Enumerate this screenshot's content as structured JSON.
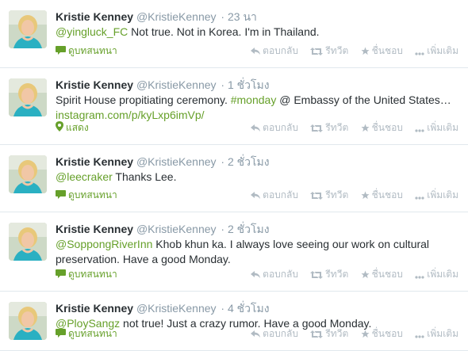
{
  "colors": {
    "link": "#66a02a",
    "muted": "#8899a6",
    "actions": "#b1bbc3",
    "border": "#e1e8ed"
  },
  "tweets": [
    {
      "name": "Kristie Kenney",
      "handle": "@KristieKenney",
      "sep": "·",
      "time": "23 นา",
      "parts": [
        {
          "t": "@yingluck_FC",
          "link": true
        },
        {
          "t": " Not true.  Not in Korea. I'm in Thailand.",
          "link": false
        }
      ],
      "expand": "ดูบทสนทนา",
      "expand_icon": "conversation-icon",
      "actions": {
        "reply": "ตอบกลับ",
        "retweet": "รีทวีต",
        "favorite": "ชื่นชอบ",
        "more": "เพิ่มเติม"
      }
    },
    {
      "name": "Kristie Kenney",
      "handle": "@KristieKenney",
      "sep": "·",
      "time": "1 ชั่วโมง",
      "parts": [
        {
          "t": "Spirit House propitiating ceremony. ",
          "link": false
        },
        {
          "t": "#monday",
          "link": true
        },
        {
          "t": " @ Embassy of the United States… ",
          "link": false
        },
        {
          "t": "instagram.com/p/kyLxp6imVp/",
          "link": true
        }
      ],
      "expand": "แสดง",
      "expand_icon": "location-pin-icon",
      "actions": {
        "reply": "ตอบกลับ",
        "retweet": "รีทวีต",
        "favorite": "ชื่นชอบ",
        "more": "เพิ่มเติม"
      }
    },
    {
      "name": "Kristie Kenney",
      "handle": "@KristieKenney",
      "sep": "·",
      "time": "2 ชั่วโมง",
      "parts": [
        {
          "t": "@leecraker",
          "link": true
        },
        {
          "t": " Thanks Lee.",
          "link": false
        }
      ],
      "expand": "ดูบทสนทนา",
      "expand_icon": "conversation-icon",
      "actions": {
        "reply": "ตอบกลับ",
        "retweet": "รีทวีต",
        "favorite": "ชื่นชอบ",
        "more": "เพิ่มเติม"
      }
    },
    {
      "name": "Kristie Kenney",
      "handle": "@KristieKenney",
      "sep": "·",
      "time": "2 ชั่วโมง",
      "parts": [
        {
          "t": "@SoppongRiverInn",
          "link": true
        },
        {
          "t": " Khob khun ka.  I always love seeing our work on cultural preservation.  Have a good Monday.",
          "link": false
        }
      ],
      "expand": "ดูบทสนทนา",
      "expand_icon": "conversation-icon",
      "actions": {
        "reply": "ตอบกลับ",
        "retweet": "รีทวีต",
        "favorite": "ชื่นชอบ",
        "more": "เพิ่มเติม"
      }
    },
    {
      "name": "Kristie Kenney",
      "handle": "@KristieKenney",
      "sep": "·",
      "time": "4 ชั่วโมง",
      "parts": [
        {
          "t": "@PloySangz",
          "link": true
        },
        {
          "t": " not true! Just a crazy rumor. Have a good Monday.",
          "link": false
        }
      ],
      "expand": "ดูบทสนทนา",
      "expand_icon": "conversation-icon",
      "actions": {
        "reply": "ตอบกลับ",
        "retweet": "รีทวีต",
        "favorite": "ชื่นชอบ",
        "more": "เพิ่มเติม"
      }
    }
  ]
}
